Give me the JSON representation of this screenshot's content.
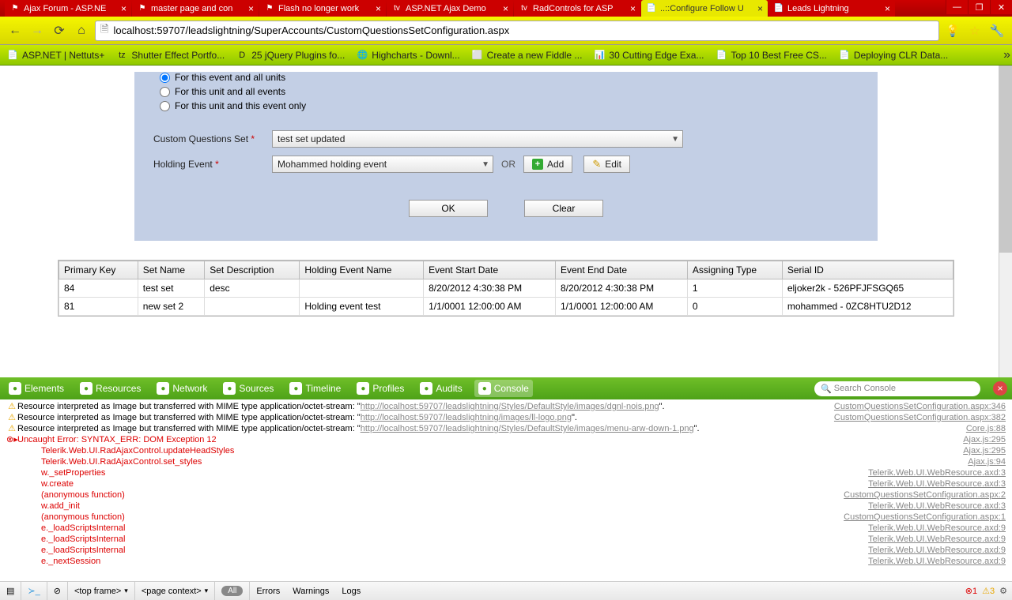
{
  "window_controls": {
    "min": "—",
    "max": "❐",
    "close": "✕"
  },
  "tabs": [
    {
      "title": "Ajax Forum - ASP.NE",
      "fav": "⚑"
    },
    {
      "title": "master page and con",
      "fav": "⚑"
    },
    {
      "title": "Flash no longer work",
      "fav": "⚑"
    },
    {
      "title": "ASP.NET Ajax Demo",
      "fav": "tv"
    },
    {
      "title": "RadControls for ASP",
      "fav": "tv"
    },
    {
      "title": "..::Configure Follow U",
      "fav": "📄",
      "active": true
    },
    {
      "title": "Leads Lightning",
      "fav": "📄"
    }
  ],
  "address": "localhost:59707/leadslightning/SuperAccounts/CustomQuestionsSetConfiguration.aspx",
  "bookmarks": [
    {
      "ico": "📄",
      "t": "ASP.NET | Nettuts+"
    },
    {
      "ico": "tz",
      "t": "Shutter Effect Portfo..."
    },
    {
      "ico": "D",
      "t": "25 jQuery Plugins fo..."
    },
    {
      "ico": "🌐",
      "t": "Highcharts - Downl..."
    },
    {
      "ico": "⬜",
      "t": "Create a new Fiddle ..."
    },
    {
      "ico": "📊",
      "t": "30 Cutting Edge Exa..."
    },
    {
      "ico": "📄",
      "t": "Top 10 Best Free CS..."
    },
    {
      "ico": "📄",
      "t": "Deploying CLR Data..."
    }
  ],
  "form": {
    "radios": [
      {
        "label": "For this event and all units",
        "checked": true
      },
      {
        "label": "For this unit and all events",
        "checked": false
      },
      {
        "label": "For this unit and this event only",
        "checked": false
      }
    ],
    "cqs_label": "Custom Questions Set",
    "cqs_value": "test set updated",
    "he_label": "Holding Event",
    "he_value": "Mohammed holding event",
    "or": "OR",
    "add": "Add",
    "edit": "Edit",
    "ok": "OK",
    "clear": "Clear"
  },
  "grid": {
    "headers": [
      "Primary Key",
      "Set Name",
      "Set Description",
      "Holding Event Name",
      "Event Start Date",
      "Event End Date",
      "Assigning Type",
      "Serial ID"
    ],
    "rows": [
      [
        "84",
        "test set",
        "desc",
        "",
        "8/20/2012 4:30:38 PM",
        "8/20/2012 4:30:38 PM",
        "1",
        "eljoker2k - 526PFJFSGQ65"
      ],
      [
        "81",
        "new set 2",
        "",
        "Holding event test",
        "1/1/0001 12:00:00 AM",
        "1/1/0001 12:00:00 AM",
        "0",
        "mohammed - 0ZC8HTU2D12"
      ]
    ]
  },
  "devtools": {
    "tabs": [
      "Elements",
      "Resources",
      "Network",
      "Sources",
      "Timeline",
      "Profiles",
      "Audits",
      "Console"
    ],
    "active": "Console",
    "search_placeholder": "Search Console",
    "logs": [
      {
        "type": "warn",
        "msg": "Resource interpreted as Image but transferred with MIME type application/octet-stream: \"",
        "url": "http://localhost:59707/leadslightning/Styles/DefaultStyle/images/dgnl-nois.png",
        "tail": "\".",
        "src": "CustomQuestionsSetConfiguration.aspx:346"
      },
      {
        "type": "warn",
        "msg": "Resource interpreted as Image but transferred with MIME type application/octet-stream: \"",
        "url": "http://localhost:59707/leadslightning/images/ll-logo.png",
        "tail": "\".",
        "src": "CustomQuestionsSetConfiguration.aspx:382"
      },
      {
        "type": "warn",
        "msg": "Resource interpreted as Image but transferred with MIME type application/octet-stream: \"",
        "url": "http://localhost:59707/leadslightning/Styles/DefaultStyle/images/menu-arw-down-1.png",
        "tail": "\".",
        "src": "Core.js:88"
      },
      {
        "type": "err",
        "msg": "Uncaught Error: SYNTAX_ERR: DOM Exception 12",
        "src": "Ajax.js:295"
      }
    ],
    "stack": [
      {
        "fn": "Telerik.Web.UI.RadAjaxControl.updateHeadStyles",
        "src": "Ajax.js:295"
      },
      {
        "fn": "Telerik.Web.UI.RadAjaxControl.set_styles",
        "src": "Ajax.js:94"
      },
      {
        "fn": "w._setProperties",
        "src": "Telerik.Web.UI.WebResource.axd:3"
      },
      {
        "fn": "w.create",
        "src": "Telerik.Web.UI.WebResource.axd:3"
      },
      {
        "fn": "(anonymous function)",
        "src": "CustomQuestionsSetConfiguration.aspx:2"
      },
      {
        "fn": "w.add_init",
        "src": "Telerik.Web.UI.WebResource.axd:3"
      },
      {
        "fn": "(anonymous function)",
        "src": "CustomQuestionsSetConfiguration.aspx:1"
      },
      {
        "fn": "e._loadScriptsInternal",
        "src": "Telerik.Web.UI.WebResource.axd:9"
      },
      {
        "fn": "e._loadScriptsInternal",
        "src": "Telerik.Web.UI.WebResource.axd:9"
      },
      {
        "fn": "e._loadScriptsInternal",
        "src": "Telerik.Web.UI.WebResource.axd:9"
      },
      {
        "fn": "e._nextSession",
        "src": "Telerik.Web.UI.WebResource.axd:9"
      }
    ],
    "footer": {
      "frame": "<top frame>",
      "context": "<page context>",
      "all": "All",
      "errors": "Errors",
      "warnings": "Warnings",
      "logs": "Logs",
      "err_count": "1",
      "warn_count": "3"
    }
  }
}
